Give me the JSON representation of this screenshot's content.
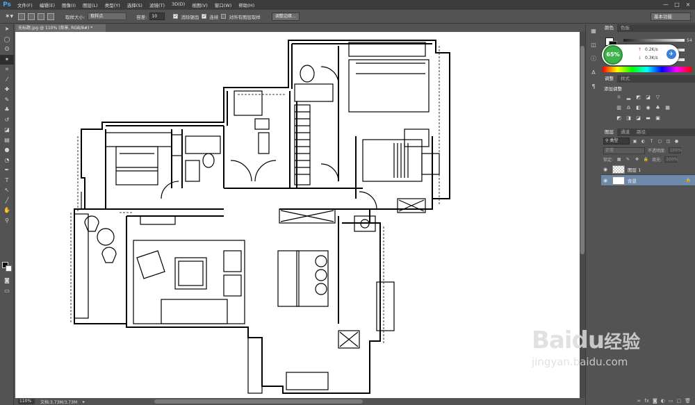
{
  "app": {
    "logo": "Ps"
  },
  "menubar": {
    "items": [
      "文件(F)",
      "编辑(E)",
      "图像(I)",
      "图层(L)",
      "类型(Y)",
      "选择(S)",
      "滤镜(T)",
      "3D(D)",
      "视图(V)",
      "窗口(W)",
      "帮助(H)"
    ],
    "window_controls": [
      "—",
      "□",
      "×"
    ]
  },
  "options": {
    "sample_size_label": "取样大小:",
    "sample_size_value": "取样点",
    "tolerance_label": "容差:",
    "tolerance_value": "10",
    "antialias_label": "消除锯齿",
    "contiguous_label": "连续",
    "sample_all_label": "对所有图层取样",
    "refine_edge_label": "调整边缘...",
    "workspace": "基本功能"
  },
  "document": {
    "tab_title": "无标题.jpg @ 110% (背景, RGB/8#) *",
    "zoom": "110%",
    "doc_size": "文档:3.73M/3.73M"
  },
  "color_panel": {
    "tabs": [
      "颜色",
      "色板"
    ],
    "values": [
      "54",
      "",
      ""
    ]
  },
  "widget": {
    "percent": "65%",
    "up_speed": "0.2K/s",
    "down_speed": "0.3K/s"
  },
  "adjustments": {
    "tabs": [
      "调整",
      "样式"
    ],
    "title": "添加调整"
  },
  "layers": {
    "tabs": [
      "图层",
      "通道",
      "路径"
    ],
    "kind": "类型",
    "blend_mode": "正常",
    "opacity_label": "不透明度:",
    "opacity_value": "100%",
    "lock_label": "锁定:",
    "fill_label": "填充:",
    "fill_value": "100%",
    "items": [
      {
        "name": "图层 1",
        "selected": false
      },
      {
        "name": "背景",
        "selected": true
      }
    ]
  },
  "watermark": {
    "logo": "Baidu",
    "cn": "经验",
    "url": "jingyan.baidu.com"
  }
}
